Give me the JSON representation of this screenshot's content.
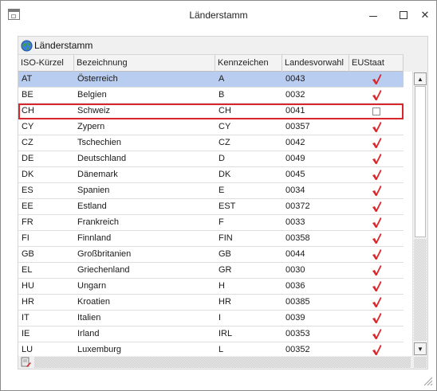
{
  "window": {
    "title": "Länderstamm",
    "icon": "app-window-icon",
    "buttons": {
      "minimize": "minimize-icon",
      "maximize": "maximize-icon",
      "close": "✕"
    }
  },
  "panel": {
    "title": "Länderstamm",
    "icon": "globe-icon"
  },
  "columns": {
    "iso": "ISO-Kürzel",
    "name": "Bezeichnung",
    "code": "Kennzeichen",
    "dial": "Landesvorwahl",
    "eu": "EUStaat"
  },
  "rows": [
    {
      "iso": "AT",
      "name": "Österreich",
      "code": "A",
      "dial": "0043",
      "eu": true,
      "state": "selected"
    },
    {
      "iso": "BE",
      "name": "Belgien",
      "code": "B",
      "dial": "0032",
      "eu": true,
      "state": ""
    },
    {
      "iso": "CH",
      "name": "Schweiz",
      "code": "CH",
      "dial": "0041",
      "eu": false,
      "state": "focused"
    },
    {
      "iso": "CY",
      "name": "Zypern",
      "code": "CY",
      "dial": "00357",
      "eu": true,
      "state": ""
    },
    {
      "iso": "CZ",
      "name": "Tschechien",
      "code": "CZ",
      "dial": "0042",
      "eu": true,
      "state": ""
    },
    {
      "iso": "DE",
      "name": "Deutschland",
      "code": "D",
      "dial": "0049",
      "eu": true,
      "state": ""
    },
    {
      "iso": "DK",
      "name": "Dänemark",
      "code": "DK",
      "dial": "0045",
      "eu": true,
      "state": ""
    },
    {
      "iso": "ES",
      "name": "Spanien",
      "code": "E",
      "dial": "0034",
      "eu": true,
      "state": ""
    },
    {
      "iso": "EE",
      "name": "Estland",
      "code": "EST",
      "dial": "00372",
      "eu": true,
      "state": ""
    },
    {
      "iso": "FR",
      "name": "Frankreich",
      "code": "F",
      "dial": "0033",
      "eu": true,
      "state": ""
    },
    {
      "iso": "FI",
      "name": "Finnland",
      "code": "FIN",
      "dial": "00358",
      "eu": true,
      "state": ""
    },
    {
      "iso": "GB",
      "name": "Großbritanien",
      "code": "GB",
      "dial": "0044",
      "eu": true,
      "state": ""
    },
    {
      "iso": "EL",
      "name": "Griechenland",
      "code": "GR",
      "dial": "0030",
      "eu": true,
      "state": ""
    },
    {
      "iso": "HU",
      "name": "Ungarn",
      "code": "H",
      "dial": "0036",
      "eu": true,
      "state": ""
    },
    {
      "iso": "HR",
      "name": "Kroatien",
      "code": "HR",
      "dial": "00385",
      "eu": true,
      "state": ""
    },
    {
      "iso": "IT",
      "name": "Italien",
      "code": "I",
      "dial": "0039",
      "eu": true,
      "state": ""
    },
    {
      "iso": "IE",
      "name": "Irland",
      "code": "IRL",
      "dial": "00353",
      "eu": true,
      "state": ""
    },
    {
      "iso": "LU",
      "name": "Luxemburg",
      "code": "L",
      "dial": "00352",
      "eu": true,
      "state": ""
    }
  ],
  "colors": {
    "selected_row": "#b9cdf0",
    "focus_border": "#d8262b",
    "check": "#d8262b"
  },
  "icons": {
    "checked": "red-checkmark-icon",
    "unchecked": "empty-checkbox-icon",
    "footer": "edit-record-icon",
    "resize": "resize-grip-icon"
  }
}
